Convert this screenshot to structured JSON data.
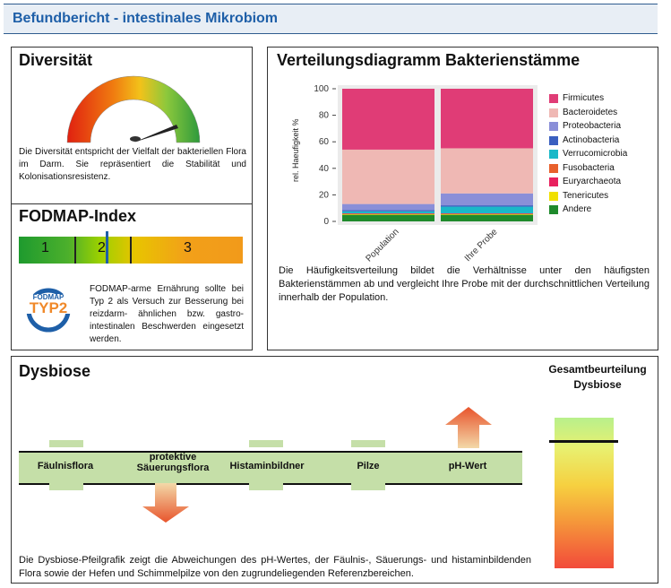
{
  "header": {
    "title": "Befundbericht - intestinales Mikrobiom"
  },
  "diversity": {
    "title": "Diversität",
    "text": "Die Diversität entspricht der Vielfalt der bakteriellen Flora im Darm. Sie repräsentiert die Stabilität und Kolonisationsresistenz."
  },
  "fodmap": {
    "title": "FODMAP-Index",
    "scale": [
      "1",
      "2",
      "3"
    ],
    "logo_top": "FODMAP",
    "logo_main": "TYP2",
    "text": "FODMAP-arme Ernährung sollte bei Typ 2 als Versuch zur Besserung bei reizdarm- ähnlichen bzw. gastro-intestinalen Beschwerden eingesetzt werden."
  },
  "distribution": {
    "title": "Verteilungsdiagramm Bakterienstämme",
    "text": "Die Häufigkeitsverteilung bildet die Verhältnisse unter den häufigsten Bakterienstämmen ab und vergleicht Ihre Probe mit der durchschnittlichen Verteilung innerhalb der Population."
  },
  "chart_data": {
    "type": "bar",
    "stacked": true,
    "categories": [
      "Population",
      "Ihre Probe"
    ],
    "ylabel": "rel. Haeufigkeit %",
    "ylim": [
      0,
      100
    ],
    "yticks": [
      0,
      20,
      40,
      60,
      80,
      100
    ],
    "series": [
      {
        "name": "Andere",
        "color": "#1f8a2c",
        "values": [
          5,
          5
        ]
      },
      {
        "name": "Tenericutes",
        "color": "#f0e000",
        "values": [
          0.5,
          0.5
        ]
      },
      {
        "name": "Euryarchaeota",
        "color": "#e8215e",
        "values": [
          0.3,
          0.3
        ]
      },
      {
        "name": "Fusobacteria",
        "color": "#e8602c",
        "values": [
          0.3,
          0.3
        ]
      },
      {
        "name": "Verrucomicrobia",
        "color": "#1ab8c8",
        "values": [
          1.5,
          5
        ]
      },
      {
        "name": "Actinobacteria",
        "color": "#3a5fc0",
        "values": [
          1,
          1
        ]
      },
      {
        "name": "Proteobacteria",
        "color": "#8a8fd8",
        "values": [
          4.5,
          9
        ]
      },
      {
        "name": "Bacteroidetes",
        "color": "#efb8b4",
        "values": [
          41,
          34
        ]
      },
      {
        "name": "Firmicutes",
        "color": "#e03c76",
        "values": [
          45.9,
          44.9
        ]
      }
    ]
  },
  "legend_order": [
    "Firmicutes",
    "Bacteroidetes",
    "Proteobacteria",
    "Actinobacteria",
    "Verrucomicrobia",
    "Fusobacteria",
    "Euryarchaeota",
    "Tenericutes",
    "Andere"
  ],
  "dysbiosis": {
    "title": "Dysbiose",
    "overall_title": "Gesamtbeurteilung Dysbiose",
    "labels": [
      "Fäulnisflora",
      "protektive Säuerungsflora",
      "Histaminbildner",
      "Pilze",
      "pH-Wert"
    ],
    "text": "Die Dysbiose-Pfeilgrafik zeigt die Abweichungen des pH-Wertes, der Fäulnis-, Säuerungs- und histaminbildenden Flora sowie der Hefen und Schimmelpilze von den zugrundeliegenden Referenzbereichen."
  }
}
